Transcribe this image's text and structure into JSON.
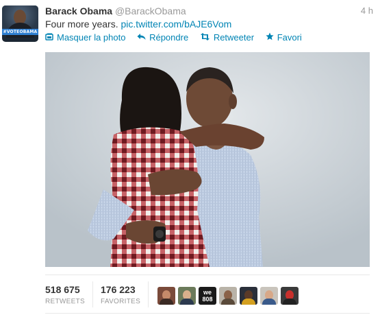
{
  "tweet": {
    "display_name": "Barack Obama",
    "handle": "@BarackObama",
    "timestamp": "4 h",
    "text": "Four more years.",
    "link": "pic.twitter.com/bAJE6Vom",
    "avatar_band": "#VOTEOBAMA"
  },
  "actions": [
    {
      "label": "Masquer la photo",
      "icon": "photo-icon"
    },
    {
      "label": "Répondre",
      "icon": "reply-icon"
    },
    {
      "label": "Retweeter",
      "icon": "retweet-icon"
    },
    {
      "label": "Favori",
      "icon": "star-icon"
    }
  ],
  "stats": {
    "retweets": {
      "value": "518 675",
      "label": "RETWEETS"
    },
    "favorites": {
      "value": "176 223",
      "label": "FAVORITES"
    }
  },
  "faces": [
    {
      "name": "user-avatar-1",
      "bg": "#7a4a3a",
      "head": "#c58a6a",
      "body": "#3b2a24"
    },
    {
      "name": "user-avatar-2",
      "bg": "#6b7a5a",
      "head": "#d9b08c",
      "body": "#2c3a4f"
    },
    {
      "name": "user-avatar-3",
      "bg": "#1a1a1a",
      "text": "we 808"
    },
    {
      "name": "user-avatar-4",
      "bg": "#b9b3a8",
      "head": "#8a6248",
      "body": "#5a4a3a"
    },
    {
      "name": "user-avatar-5",
      "bg": "#2a2f3a",
      "head": "#5a3a28",
      "body": "#d4a020"
    },
    {
      "name": "user-avatar-6",
      "bg": "#c9c4bc",
      "head": "#d8a888",
      "body": "#3a5a8a"
    },
    {
      "name": "user-avatar-7",
      "bg": "#3a3a3a",
      "head": "#c8302c",
      "body": "#222222"
    }
  ],
  "colors": {
    "link": "#0084b4",
    "muted": "#999999",
    "text": "#333333"
  }
}
